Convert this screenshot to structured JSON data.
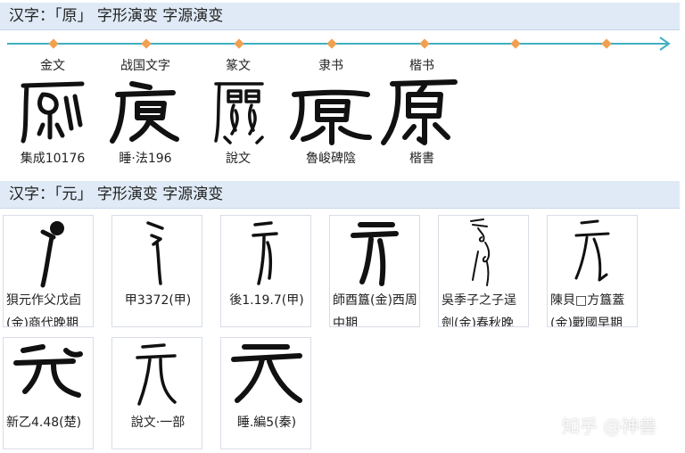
{
  "section1": {
    "title": "汉字：「原」 字形演变 字源演变",
    "stages": [
      {
        "name": "金文",
        "source": "集成10176"
      },
      {
        "name": "战国文字",
        "source": "睡·法196"
      },
      {
        "name": "篆文",
        "source": "說文"
      },
      {
        "name": "隶书",
        "source": "魯峻碑陰"
      },
      {
        "name": "楷书",
        "source": "楷書"
      }
    ]
  },
  "section2": {
    "title": "汉字：「元」 字形演变 字源演变",
    "cells": [
      {
        "caption": "狽元作父戊卣(金)商代晚期"
      },
      {
        "caption": "甲3372(甲)"
      },
      {
        "caption": "後1.19.7(甲)"
      },
      {
        "caption": "師酉簋(金)西周中期"
      },
      {
        "caption": "吳季子之子逞劍(金)春秋晚"
      },
      {
        "caption": "陳貝□方簋蓋(金)戰國早期"
      },
      {
        "caption": "新乙4.48(楚)"
      },
      {
        "caption": "說文·一部"
      },
      {
        "caption": "睡.編5(秦)"
      }
    ]
  },
  "watermark": "知乎 @神兽",
  "colors": {
    "header_bg": "#dfeaf6",
    "timeline": "#3fb0c0",
    "dot": "#f0a050"
  }
}
